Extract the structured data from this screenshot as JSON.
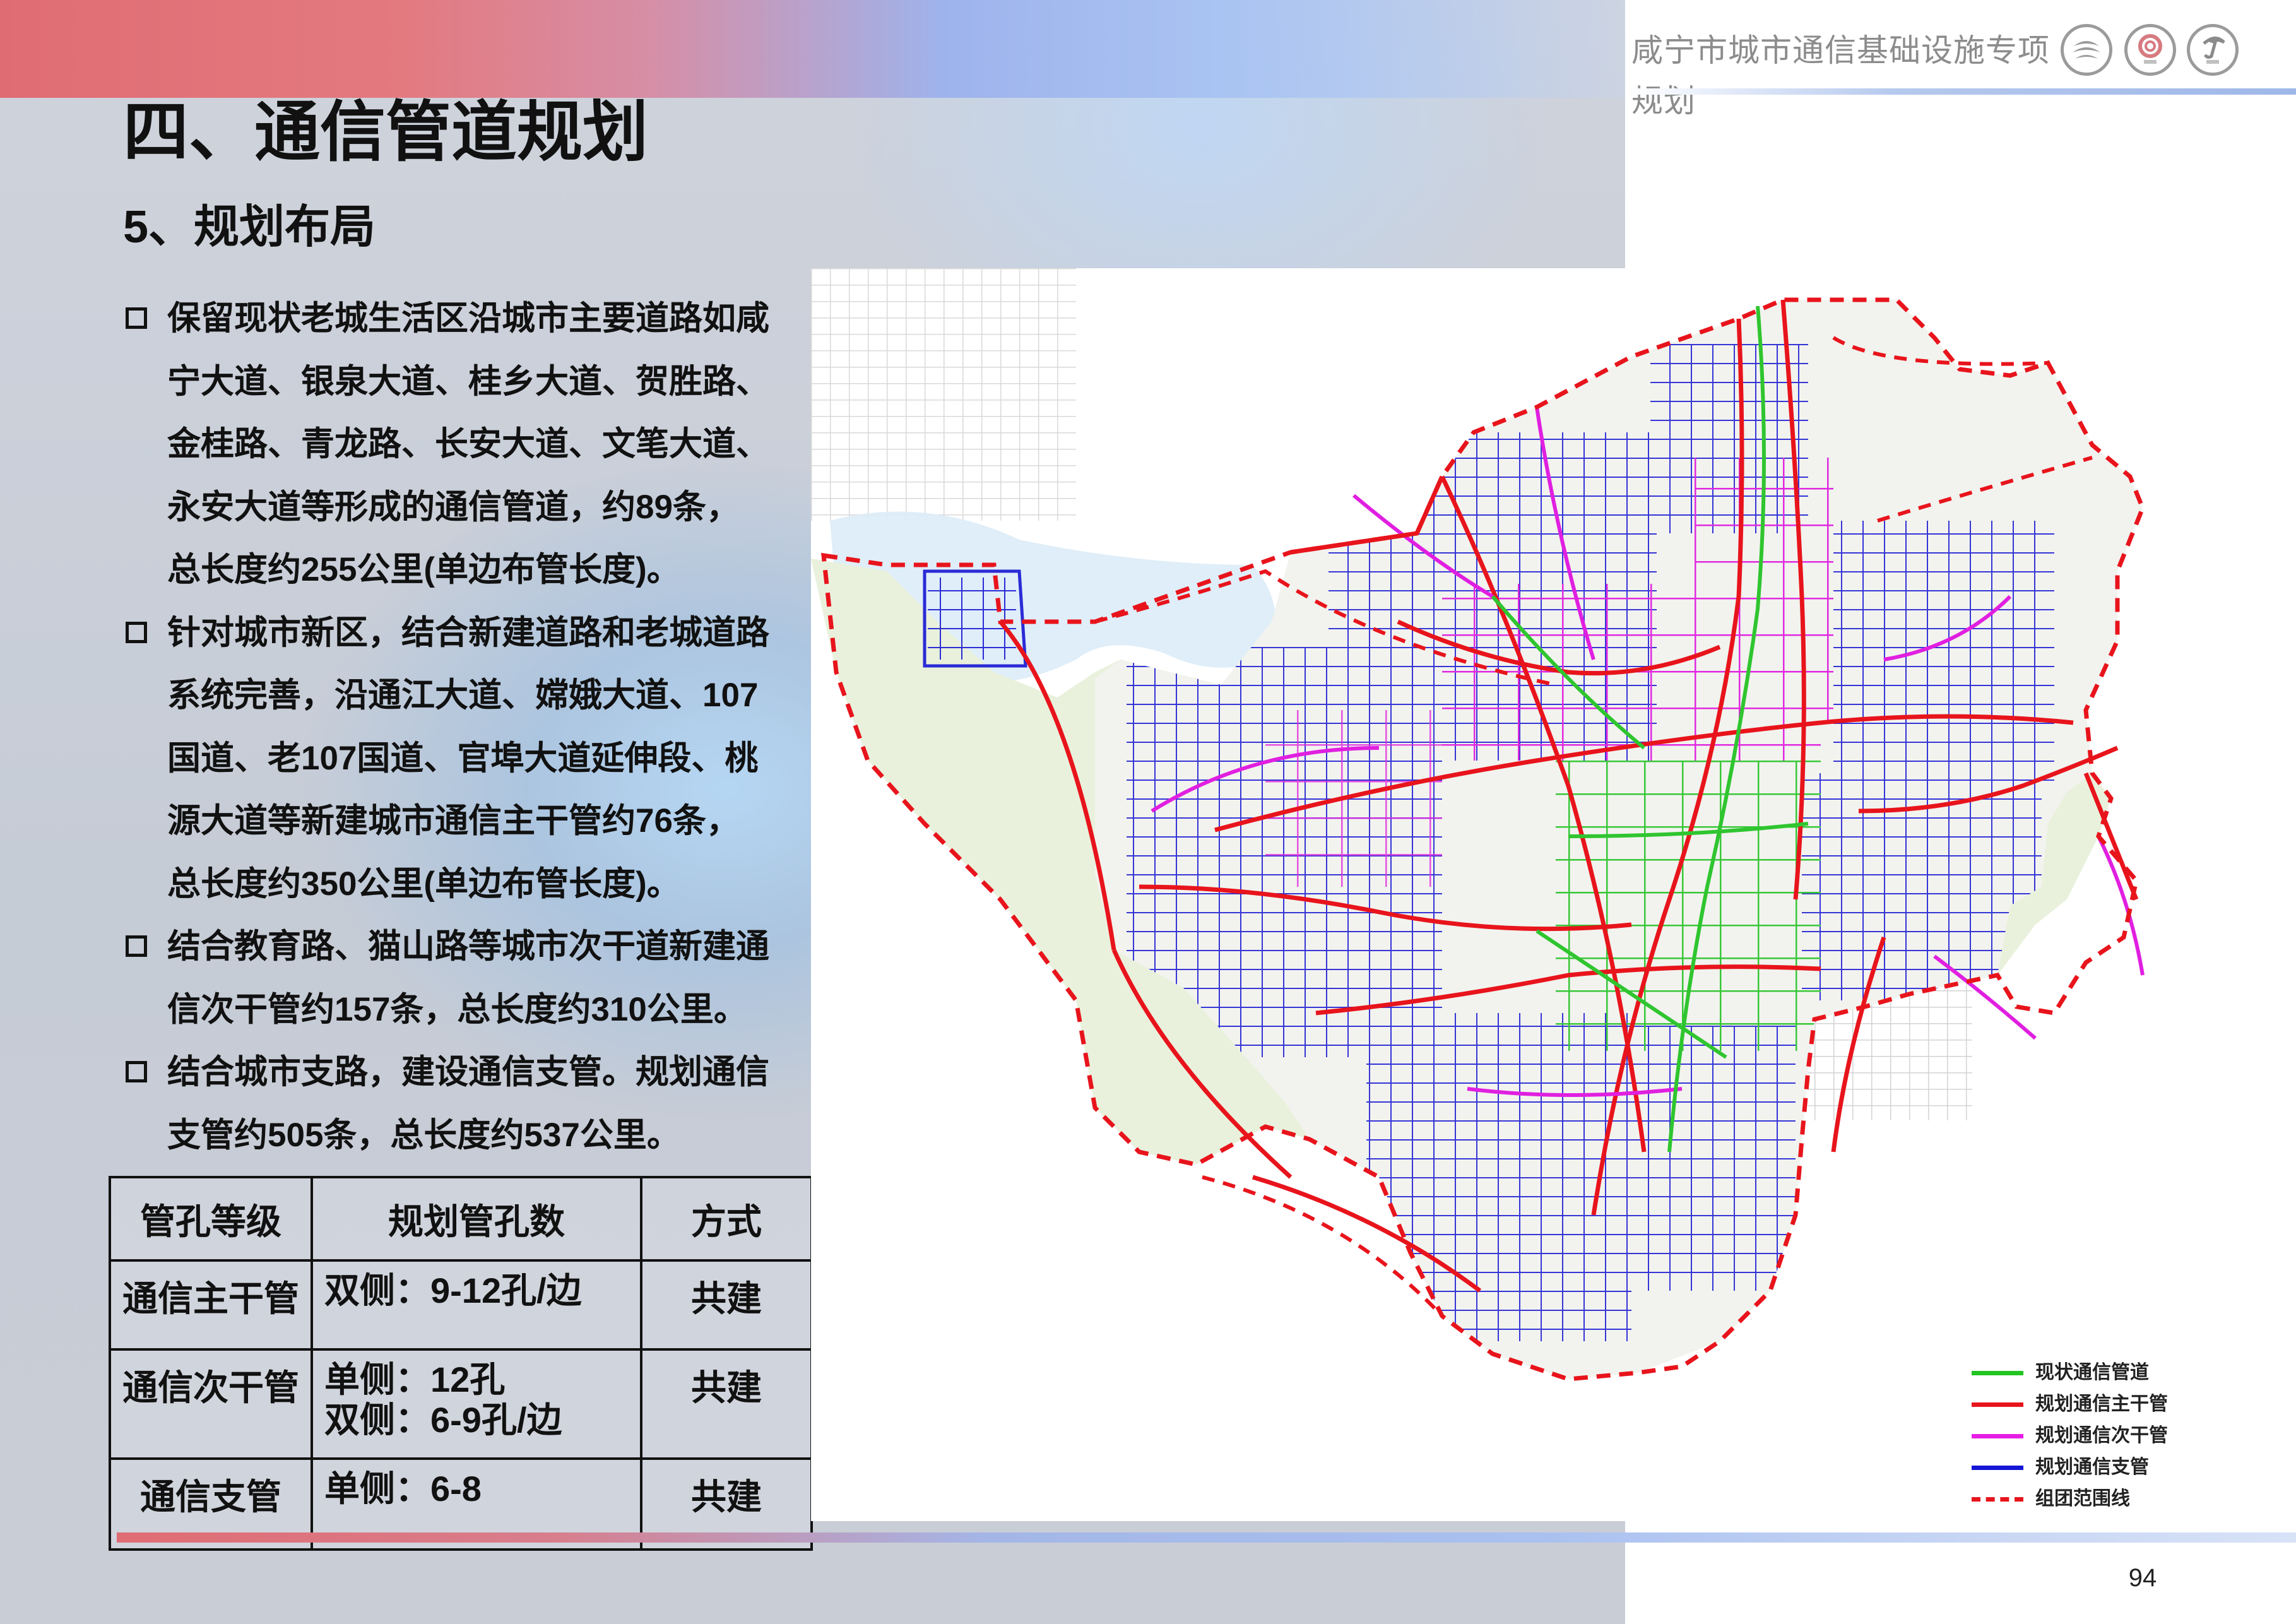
{
  "header": {
    "title": "咸宁市城市通信基础设施专项规划",
    "logos": [
      {
        "icon": "china-mobile-logo-icon"
      },
      {
        "icon": "china-unicom-logo-icon"
      },
      {
        "icon": "china-telecom-logo-icon"
      }
    ]
  },
  "heading": "四、通信管道规划",
  "subheading": "5、规划布局",
  "bullets": [
    {
      "lines": [
        "保留现状老城生活区沿城市主要道路如咸",
        "宁大道、银泉大道、桂乡大道、贺胜路、",
        "金桂路、青龙路、长安大道、文笔大道、",
        "永安大道等形成的通信管道，约89条，",
        "总长度约255公里(单边布管长度)。"
      ]
    },
    {
      "lines": [
        "针对城市新区，结合新建道路和老城道路",
        "系统完善，沿通江大道、嫦娥大道、107",
        "国道、老107国道、官埠大道延伸段、桃",
        "源大道等新建城市通信主干管约76条，",
        "总长度约350公里(单边布管长度)。"
      ]
    },
    {
      "lines": [
        "结合教育路、猫山路等城市次干道新建通",
        "信次干管约157条，总长度约310公里。"
      ]
    },
    {
      "lines": [
        "结合城市支路，建设通信支管。规划通信",
        "支管约505条，总长度约537公里。"
      ]
    }
  ],
  "table": {
    "headers": [
      "管孔等级",
      "规划管孔数",
      "方式"
    ],
    "rows": [
      {
        "level": "通信主干管",
        "count": [
          "双侧：9-12孔/边"
        ],
        "mode": "共建"
      },
      {
        "level": "通信次干管",
        "count": [
          "单侧：12孔",
          "双侧：6-9孔/边"
        ],
        "mode": "共建"
      },
      {
        "level": "通信支管",
        "count": [
          "单侧：6-8"
        ],
        "mode": "共建"
      }
    ]
  },
  "legend": [
    {
      "label": "现状通信管道",
      "color": "#22c422",
      "style": "solid"
    },
    {
      "label": "规划通信主干管",
      "color": "#e8141c",
      "style": "solid"
    },
    {
      "label": "规划通信次干管",
      "color": "#e61ee6",
      "style": "solid"
    },
    {
      "label": "规划通信支管",
      "color": "#1515d8",
      "style": "solid"
    },
    {
      "label": "组团范围线",
      "color": "#e8141c",
      "style": "dashed"
    }
  ],
  "page_number": "94"
}
